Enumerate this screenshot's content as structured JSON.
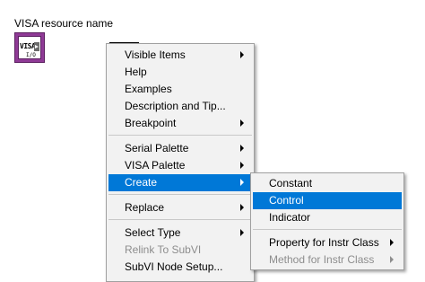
{
  "node": {
    "label": "VISA resource name",
    "icon_text": "VISA",
    "icon_subtext": "I/O"
  },
  "colors": {
    "menu_bg": "#f2f2f2",
    "highlight": "#0078d7",
    "node_purple": "#8f3a96",
    "disabled_text": "#8d8d8d"
  },
  "context_menu": {
    "items": [
      {
        "label": "Visible Items",
        "submenu": true
      },
      {
        "label": "Help"
      },
      {
        "label": "Examples"
      },
      {
        "label": "Description and Tip..."
      },
      {
        "label": "Breakpoint",
        "submenu": true
      },
      {
        "label": "Serial Palette",
        "submenu": true
      },
      {
        "label": "VISA Palette",
        "submenu": true
      },
      {
        "label": "Create",
        "submenu": true,
        "highlighted": true
      },
      {
        "label": "Replace",
        "submenu": true
      },
      {
        "label": "Select Type",
        "submenu": true
      },
      {
        "label": "Relink To SubVI",
        "disabled": true
      },
      {
        "label": "SubVI Node Setup..."
      }
    ]
  },
  "create_submenu": {
    "items": [
      {
        "label": "Constant"
      },
      {
        "label": "Control",
        "highlighted": true
      },
      {
        "label": "Indicator"
      },
      {
        "label": "Property for Instr Class",
        "submenu": true
      },
      {
        "label": "Method for Instr Class",
        "submenu": true,
        "disabled": true
      }
    ]
  }
}
